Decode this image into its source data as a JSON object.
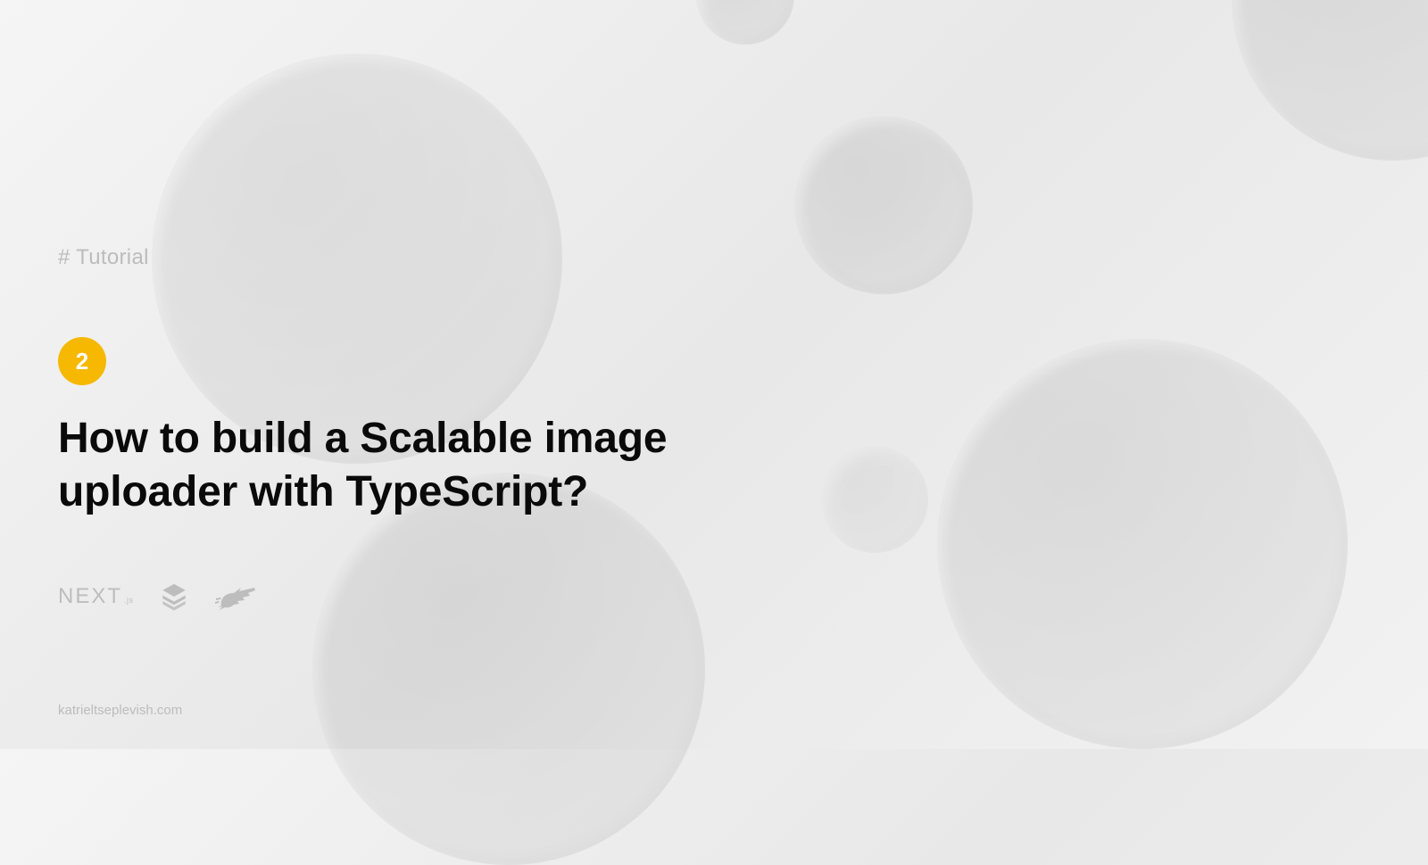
{
  "tag": "# Tutorial",
  "badge": "2",
  "title": "How to build a Scalable image uploader with TypeScript?",
  "footer": "katrieltseplevish.com",
  "tech": {
    "next_label": "NEXT",
    "next_sub": ".js"
  }
}
